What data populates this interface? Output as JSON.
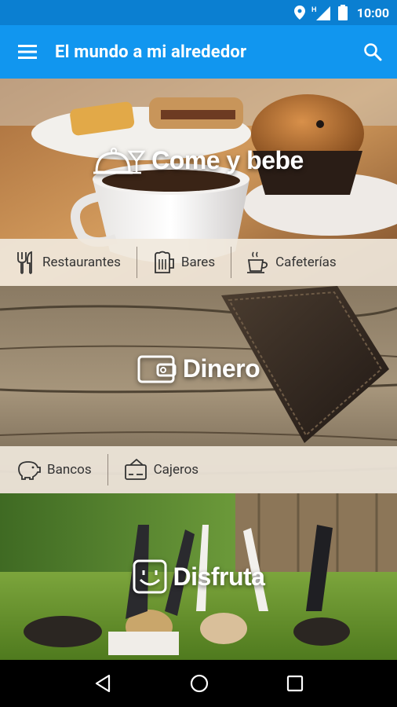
{
  "status_bar": {
    "time": "10:00",
    "network": "H"
  },
  "app_bar": {
    "title": "El mundo a mi alrededor"
  },
  "sections": [
    {
      "title": "Come y bebe",
      "icon": "food-service-cloche-cocktail-icon",
      "chips": [
        {
          "label": "Restaurantes",
          "icon": "fork-knife-icon"
        },
        {
          "label": "Bares",
          "icon": "beer-mug-icon"
        },
        {
          "label": "Cafeterías",
          "icon": "coffee-cup-icon"
        }
      ]
    },
    {
      "title": "Dinero",
      "icon": "wallet-icon",
      "chips": [
        {
          "label": "Bancos",
          "icon": "piggy-bank-icon"
        },
        {
          "label": "Cajeros",
          "icon": "atm-card-icon"
        }
      ]
    },
    {
      "title": "Disfruta",
      "icon": "smiley-icon",
      "chips": []
    }
  ],
  "colors": {
    "status_bar": "#0b7fd1",
    "app_bar": "#1196ef",
    "chip_bar": "#f0e8dc"
  }
}
